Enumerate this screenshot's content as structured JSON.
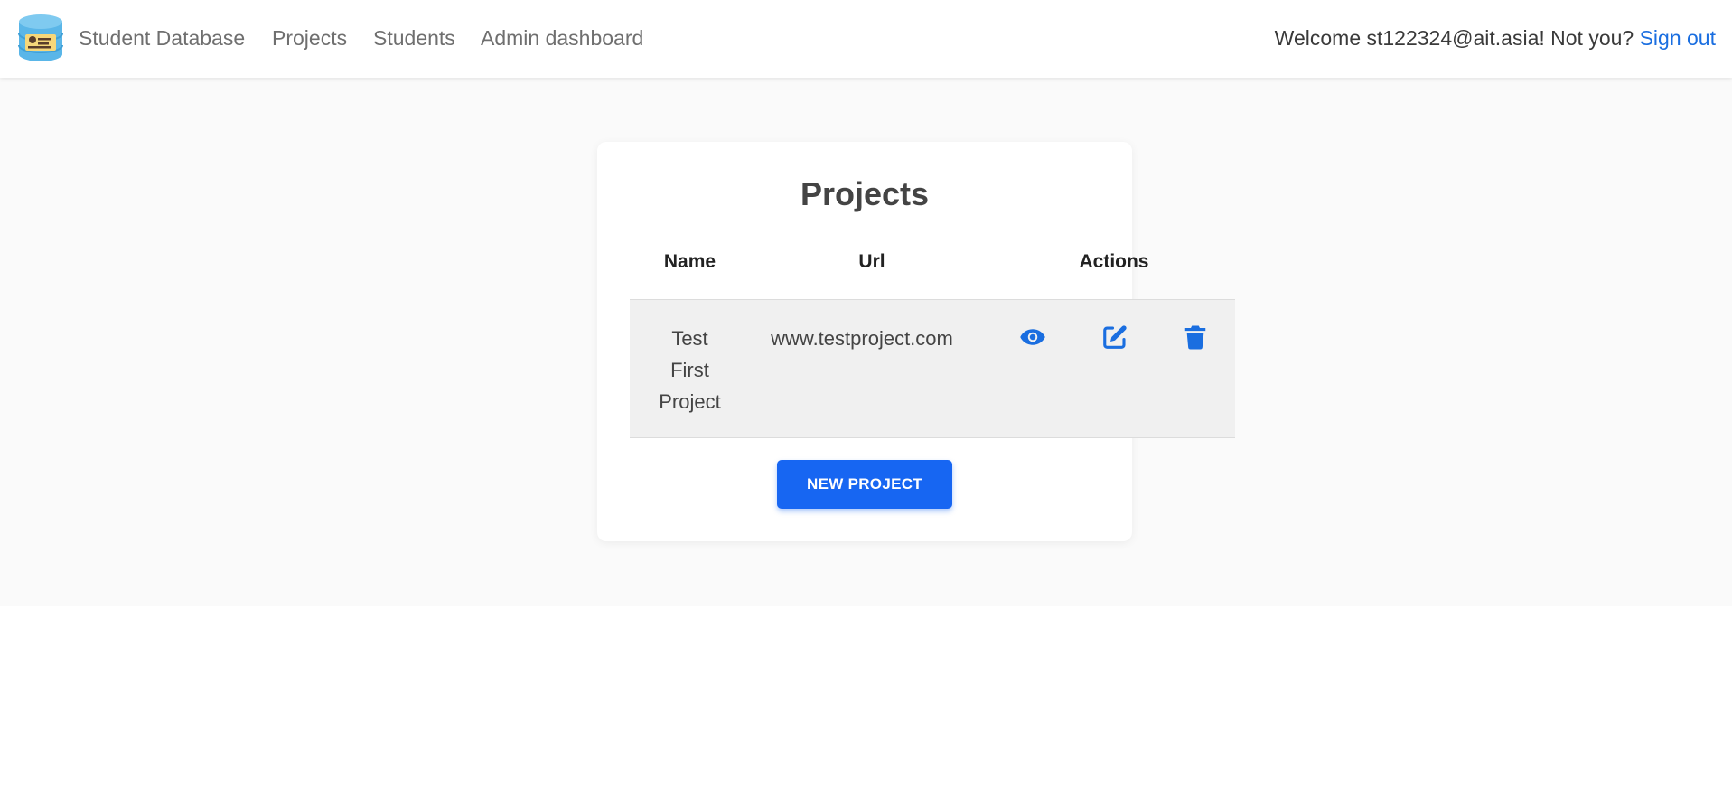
{
  "navbar": {
    "brand": "Student Database",
    "links": [
      "Projects",
      "Students",
      "Admin dashboard"
    ],
    "welcome_text": "Welcome st122324@ait.asia! Not you?",
    "signout_label": "Sign out"
  },
  "projects": {
    "title": "Projects",
    "columns": [
      "Name",
      "Url",
      "Actions"
    ],
    "rows": [
      {
        "name_lines": [
          "Test",
          "First",
          "Project"
        ],
        "url": "www.testproject.com",
        "actions": [
          "eye-icon",
          "edit-icon",
          "trash-icon"
        ]
      }
    ],
    "new_button_label": "NEW PROJECT"
  },
  "colors": {
    "accent": "#1766f2",
    "link": "#1a6ee0",
    "page_background": "#fafafa"
  }
}
